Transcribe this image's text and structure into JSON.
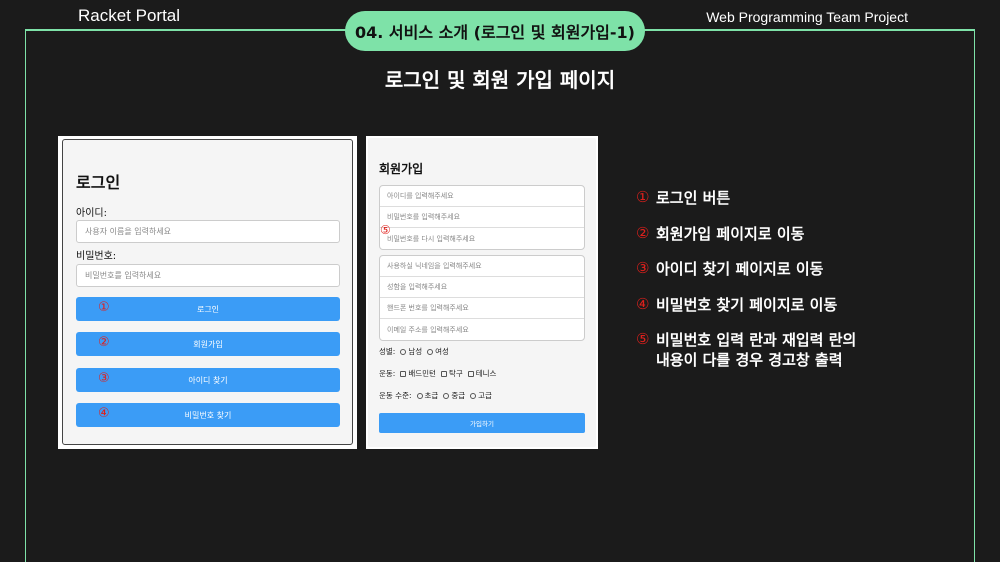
{
  "header": {
    "brand": "Racket Portal",
    "section": "04. 서비스 소개 (로그인 및 회원가입-1)",
    "project": "Web Programming Team Project"
  },
  "page_title": "로그인 및 회원 가입 페이지",
  "login": {
    "title": "로그인",
    "id_label": "아이디:",
    "id_placeholder": "사용자 이름을 입력하세요",
    "pw_label": "비밀번호:",
    "pw_placeholder": "비밀번호를 입력하세요",
    "buttons": [
      {
        "num": "①",
        "label": "로그인"
      },
      {
        "num": "②",
        "label": "회원가입"
      },
      {
        "num": "③",
        "label": "아이디 찾기"
      },
      {
        "num": "④",
        "label": "비밀번호 찾기"
      }
    ]
  },
  "signup": {
    "title": "회원가입",
    "marker": "⑤",
    "group1": [
      "아이디를 입력해주세요",
      "비밀번호를 입력해주세요",
      "비밀번호를 다시 입력해주세요"
    ],
    "group2": [
      "사용하실 닉네임을 입력해주세요",
      "성함을 입력해주세요",
      "핸드폰 번호를 입력해주세요",
      "이메일 주소를 입력해주세요"
    ],
    "gender_label": "성별:",
    "gender_options": [
      "남성",
      "여성"
    ],
    "sport_label": "운동:",
    "sport_options": [
      "배드민턴",
      "탁구",
      "테니스"
    ],
    "level_label": "운동 수준:",
    "level_options": [
      "초급",
      "중급",
      "고급"
    ],
    "submit": "가입하기"
  },
  "descriptions": [
    {
      "num": "①",
      "text": "로그인 버튼"
    },
    {
      "num": "②",
      "text": "회원가입 페이지로 이동"
    },
    {
      "num": "③",
      "text": "아이디 찾기 페이지로 이동"
    },
    {
      "num": "④",
      "text": "비밀번호 찾기 페이지로 이동"
    },
    {
      "num": "⑤",
      "text": "비밀번호 입력 란과 재입력 란의\n내용이 다를 경우 경고창 출력"
    }
  ],
  "colors": {
    "accent": "#7ee2a8",
    "button": "#3b9cf6",
    "marker": "#e0201c",
    "background": "#1b1b1b"
  }
}
